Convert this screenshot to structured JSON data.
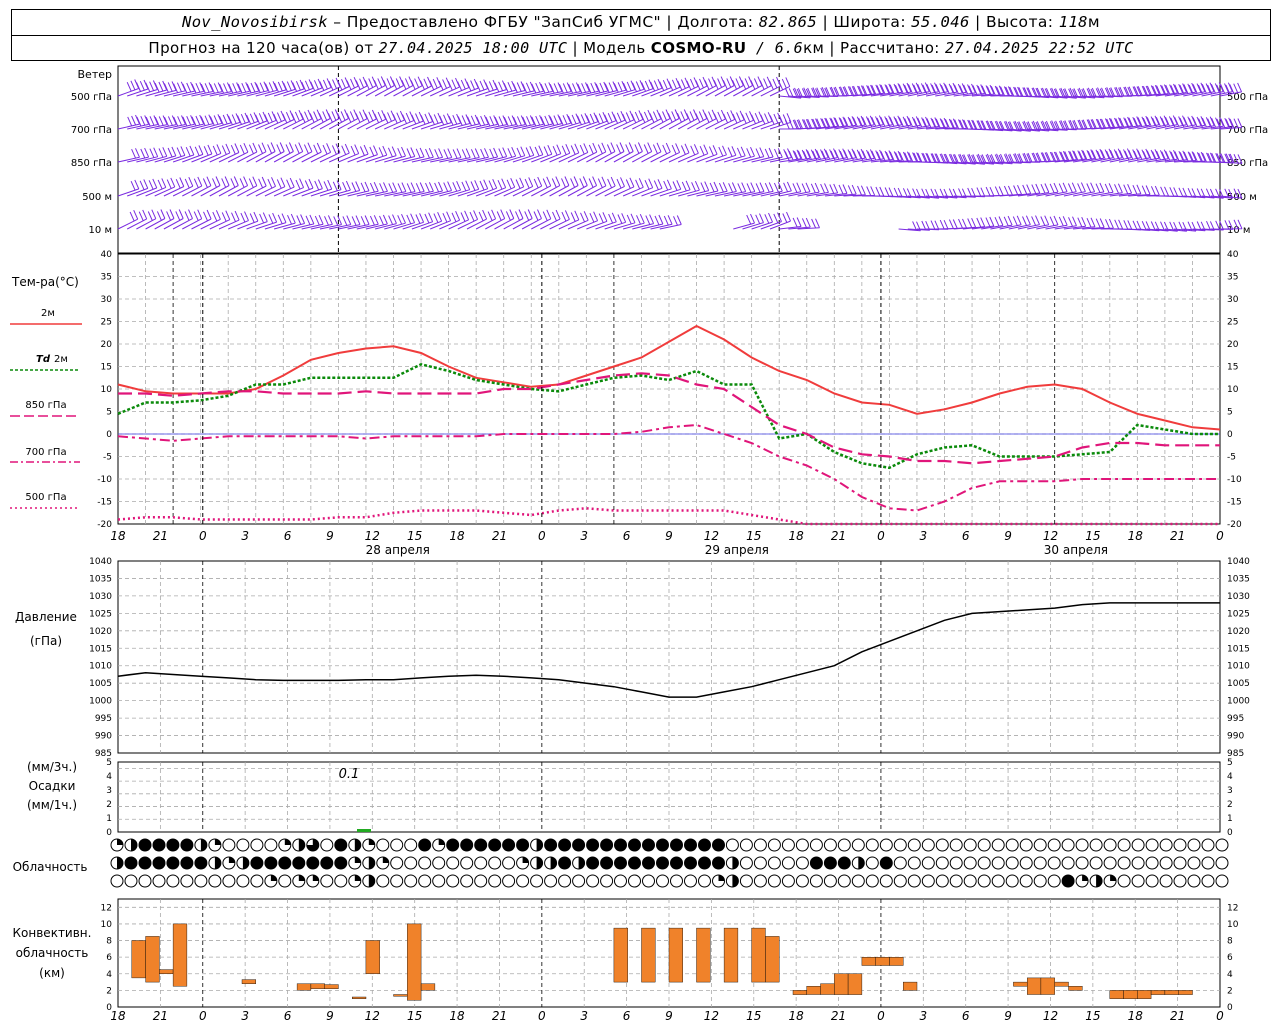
{
  "header": {
    "station": "Nov_Novosibirsk",
    "provider": " – Предоставлено ФГБУ \"ЗапСиб УГМС\" | Долгота: ",
    "lon": "82.865",
    "lat_label": " | Широта: ",
    "lat": "55.046",
    "alt_label": " | Высота: ",
    "alt": "118",
    "alt_unit": "м",
    "forecast_label": "Прогноз на 120 часа(ов) от ",
    "forecast_from": "27.04.2025 18:00 UTC",
    "model_label": "  | Модель ",
    "model": "COSMO-RU",
    "model_res": " / 6.6",
    "model_res_unit": "км",
    "calc_label": " | Рассчитано: ",
    "calc_time": "27.04.2025 22:52 UTC"
  },
  "labels": {
    "wind": "Ветер",
    "wind_levels": [
      "500 гПа",
      "700 гПа",
      "850 гПа",
      "500 м",
      "10  м"
    ],
    "temp_title": "Тем-ра(°C)",
    "legend_2m": "2м",
    "legend_td": "Td",
    "legend_td2": "2м",
    "legend_850": "850 гПа",
    "legend_700": "700 гПа",
    "legend_500": "500 гПа",
    "pressure_title": "Давление",
    "pressure_unit": "(гПа)",
    "precip_unit3": "(мм/3ч.)",
    "precip_title": "Осадки",
    "precip_unit1": "(мм/1ч.)",
    "precip_value": "0.1",
    "clouds": "Облачность",
    "conv1": "Конвективн.",
    "conv2": "облачность",
    "conv3": "(км)"
  },
  "time_axis": {
    "ticks": [
      "18",
      "21",
      "0",
      "3",
      "6",
      "9",
      "12",
      "15",
      "18",
      "21",
      "0",
      "3",
      "6",
      "9",
      "12",
      "15",
      "18",
      "21",
      "0",
      "3",
      "6",
      "9",
      "12",
      "15",
      "18",
      "21",
      "0"
    ],
    "dates": [
      "28 апреля",
      "29 апреля",
      "30 апреля"
    ]
  },
  "colors": {
    "t2m": "#f03c3c",
    "td": "#0a8a0a",
    "t850": "#e0157a",
    "t700": "#e0157a",
    "t500": "#e0157a",
    "wind": "#7a2be0",
    "conv": "#f0822a",
    "precip": "#22aa22",
    "zero": "#3a3ae0"
  },
  "chart_data": [
    {
      "type": "line",
      "title": "Тем-ра(°C)",
      "ylim": [
        -20,
        40
      ],
      "x_hours": [
        0,
        3,
        6,
        9,
        12,
        15,
        18,
        21,
        24,
        27,
        30,
        33,
        36,
        39,
        42,
        45,
        48,
        51,
        54,
        57,
        60,
        63,
        66,
        69,
        72,
        75,
        78,
        81,
        84,
        87,
        90,
        93,
        96,
        99,
        102,
        105,
        108,
        111,
        114,
        117,
        120
      ],
      "series": [
        {
          "name": "2м",
          "values": [
            11,
            9.5,
            9,
            9,
            9,
            10,
            13,
            16.5,
            18,
            19,
            19.5,
            18,
            15,
            12.5,
            11.5,
            10.5,
            11,
            13,
            15,
            17,
            20.5,
            24,
            21,
            17,
            14,
            12,
            9,
            7,
            6.5,
            4.5,
            5.5,
            7,
            9,
            10.5,
            11,
            10,
            7,
            4.5,
            3,
            1.5,
            1
          ]
        },
        {
          "name": "Td 2м",
          "values": [
            4.5,
            7,
            7,
            7.5,
            8.5,
            11,
            11,
            12.5,
            12.5,
            12.5,
            12.5,
            15.5,
            14,
            12,
            11,
            10,
            9.5,
            11,
            12.5,
            13,
            12,
            14,
            11,
            11,
            -1,
            0,
            -4,
            -6.5,
            -7.5,
            -4.5,
            -3,
            -2.5,
            -5,
            -5,
            -5,
            -4.5,
            -4,
            2,
            1,
            0,
            0
          ]
        },
        {
          "name": "850 гПа",
          "values": [
            9,
            9,
            8.5,
            9,
            9.5,
            9.5,
            9,
            9,
            9,
            9.5,
            9,
            9,
            9,
            9,
            10,
            10,
            11,
            12,
            13,
            13.5,
            13,
            11,
            10,
            6,
            2,
            0,
            -3,
            -4.5,
            -5,
            -6,
            -6,
            -6.5,
            -6,
            -5.5,
            -5,
            -3,
            -2,
            -2,
            -2.5,
            -2.5,
            -2.5
          ]
        },
        {
          "name": "700 гПа",
          "values": [
            -0.5,
            -1,
            -1.5,
            -1,
            -0.5,
            -0.5,
            -0.5,
            -0.5,
            -0.5,
            -1,
            -0.5,
            -0.5,
            -0.5,
            -0.5,
            0,
            0,
            0,
            0,
            0,
            0.5,
            1.5,
            2,
            0,
            -2,
            -5,
            -7,
            -10,
            -14,
            -16.5,
            -17,
            -15,
            -12,
            -10.5,
            -10.5,
            -10.5,
            -10,
            -10,
            -10,
            -10,
            -10,
            -10
          ]
        },
        {
          "name": "500 гПа",
          "values": [
            -19,
            -18.5,
            -18.5,
            -19,
            -19,
            -19,
            -19,
            -19,
            -18.5,
            -18.5,
            -17.5,
            -17,
            -17,
            -17,
            -17.5,
            -18,
            -17,
            -16.5,
            -17,
            -17,
            -17,
            -17,
            -17,
            -18,
            -19,
            -20,
            -21,
            -22,
            -23,
            -24,
            -24,
            -24,
            -24,
            -24,
            -24,
            -24,
            -24,
            -24,
            -24,
            -24,
            -24
          ]
        }
      ]
    },
    {
      "type": "line",
      "title": "Давление",
      "ylabel": "(гПа)",
      "ylim": [
        985,
        1040
      ],
      "x_hours": [
        0,
        3,
        6,
        9,
        12,
        15,
        18,
        21,
        24,
        27,
        30,
        33,
        36,
        39,
        42,
        45,
        48,
        51,
        54,
        57,
        60,
        63,
        66,
        69,
        72,
        75,
        78,
        81,
        84,
        87,
        90,
        93,
        96,
        99,
        102,
        105,
        108,
        111,
        114,
        117,
        120
      ],
      "series": [
        {
          "name": "Давление",
          "values": [
            1007,
            1008,
            1007.5,
            1007,
            1006.5,
            1006,
            1005.8,
            1005.8,
            1005.8,
            1006,
            1006,
            1006.5,
            1007,
            1007.3,
            1007,
            1006.5,
            1006,
            1005,
            1004,
            1002.5,
            1001,
            1001,
            1002.5,
            1004,
            1006,
            1008,
            1010,
            1014,
            1017,
            1020,
            1023,
            1025,
            1025.5,
            1026,
            1026.5,
            1027.5,
            1028,
            1028,
            1028,
            1028,
            1028
          ]
        }
      ]
    },
    {
      "type": "bar",
      "title": "Осадки",
      "ylim": [
        0,
        5
      ],
      "data_labels": [
        {
          "x_hour": 30,
          "value": 0.1
        }
      ]
    },
    {
      "type": "bar",
      "title": "Конвективн. облачность (км)",
      "ylim": [
        0,
        13
      ],
      "bars": [
        [
          1,
          3.5,
          8
        ],
        [
          2,
          3,
          8.5
        ],
        [
          3,
          4,
          4.5
        ],
        [
          4,
          2.5,
          10
        ],
        [
          9,
          2.8,
          3.3
        ],
        [
          13,
          2,
          2.8
        ],
        [
          14,
          2.2,
          2.8
        ],
        [
          15,
          2.2,
          2.7
        ],
        [
          17,
          1,
          1.2
        ],
        [
          18,
          4,
          8
        ],
        [
          20,
          1.3,
          1.5
        ],
        [
          21,
          0.8,
          10
        ],
        [
          22,
          2,
          2.8
        ],
        [
          36,
          3,
          9.5
        ],
        [
          38,
          3,
          9.5
        ],
        [
          40,
          3,
          9.5
        ],
        [
          42,
          3,
          9.5
        ],
        [
          44,
          3,
          9.5
        ],
        [
          46,
          3,
          9.5
        ],
        [
          47,
          3,
          8.5
        ],
        [
          49,
          1.5,
          2
        ],
        [
          50,
          1.5,
          2.5
        ],
        [
          51,
          1.5,
          2.8
        ],
        [
          52,
          1.5,
          4
        ],
        [
          53,
          1.5,
          4
        ],
        [
          54,
          5,
          6
        ],
        [
          55,
          5,
          6
        ],
        [
          56,
          5,
          6
        ],
        [
          57,
          2,
          3
        ],
        [
          65,
          2.5,
          3
        ],
        [
          66,
          1.5,
          3.5
        ],
        [
          67,
          1.5,
          3.5
        ],
        [
          68,
          2.5,
          3
        ],
        [
          69,
          2,
          2.5
        ],
        [
          72,
          1,
          2
        ],
        [
          73,
          1,
          2
        ],
        [
          74,
          1,
          2
        ],
        [
          75,
          1.5,
          2
        ],
        [
          76,
          1.5,
          2
        ],
        [
          77,
          1.5,
          2
        ]
      ]
    }
  ]
}
